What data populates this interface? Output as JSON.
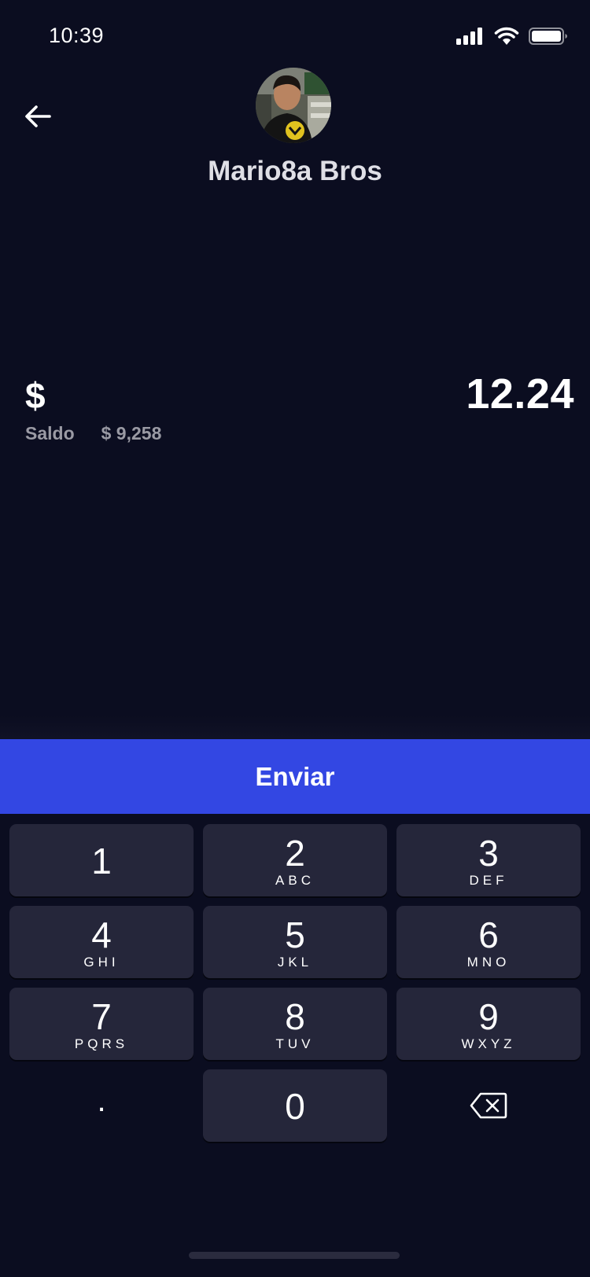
{
  "status_bar": {
    "time": "10:39",
    "icons": [
      "signal-icon",
      "wifi-icon",
      "battery-icon"
    ]
  },
  "header": {
    "back_icon": "arrow-left-icon",
    "contact_name": "Mario8a Bros"
  },
  "amount": {
    "currency_symbol": "$",
    "value": "12.24",
    "balance_label": "Saldo",
    "balance_value": "$ 9,258"
  },
  "send_button": {
    "label": "Enviar"
  },
  "keypad": {
    "keys": [
      {
        "digit": "1",
        "letters": ""
      },
      {
        "digit": "2",
        "letters": "ABC"
      },
      {
        "digit": "3",
        "letters": "DEF"
      },
      {
        "digit": "4",
        "letters": "GHI"
      },
      {
        "digit": "5",
        "letters": "JKL"
      },
      {
        "digit": "6",
        "letters": "MNO"
      },
      {
        "digit": "7",
        "letters": "PQRS"
      },
      {
        "digit": "8",
        "letters": "TUV"
      },
      {
        "digit": "9",
        "letters": "WXYZ"
      },
      {
        "digit": "0",
        "letters": ""
      }
    ],
    "decimal_label": ".",
    "delete_icon": "backspace-icon"
  },
  "colors": {
    "background": "#0b0d20",
    "accent": "#3347e3",
    "key_background": "#25263a"
  }
}
